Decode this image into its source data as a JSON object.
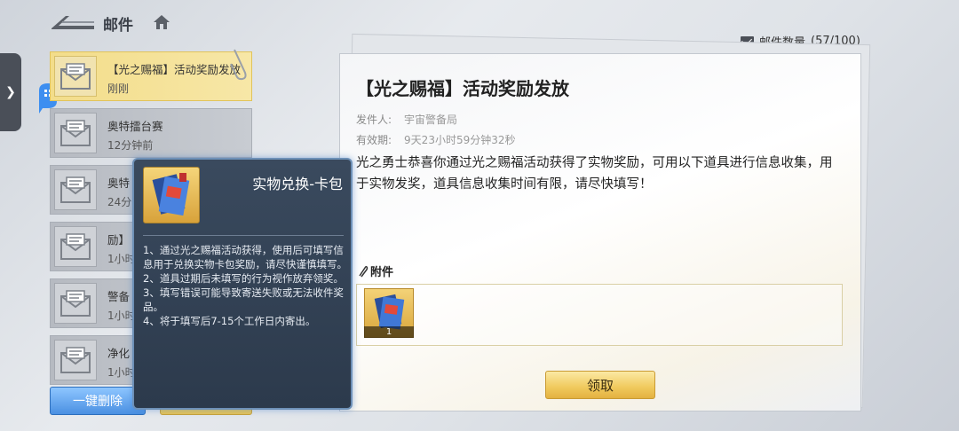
{
  "header": {
    "title": "邮件",
    "mail_count_label": "邮件数量",
    "mail_count_value": "(57/100)"
  },
  "mail_list": [
    {
      "subject": "【光之赐福】活动奖励发放",
      "time": "刚刚",
      "selected": true
    },
    {
      "subject": "奥特擂台赛",
      "time": "12分钟前",
      "selected": false
    },
    {
      "subject": "奥特",
      "time": "24分",
      "selected": false
    },
    {
      "subject": "励】",
      "time": "1小时",
      "selected": false
    },
    {
      "subject": "警备",
      "time": "1小时",
      "selected": false
    },
    {
      "subject": "净化",
      "time": "1小时",
      "selected": false
    }
  ],
  "buttons": {
    "delete_all": "一键删除",
    "claim": "领取"
  },
  "mail_detail": {
    "title": "【光之赐福】活动奖励发放",
    "sender_label": "发件人:",
    "sender": "宇宙警备局",
    "expiry_label": "有效期:",
    "expiry": "9天23小时59分钟32秒",
    "body": "光之勇士恭喜你通过光之赐福活动获得了实物奖励，可用以下道具进行信息收集，用于实物发奖，道具信息收集时间有限，请尽快填写！",
    "attachment_label": "附件",
    "attachment_qty": "1"
  },
  "tooltip": {
    "title": "实物兑换-卡包",
    "lines": [
      "1、通过光之赐福活动获得，使用后可填写信息用于兑换实物卡包奖励，请尽快谨慎填写。",
      "2、道具过期后未填写的行为视作放弃领奖。",
      "3、填写错误可能导致寄送失败或无法收件奖品。",
      "4、将于填写后7-15个工作日内寄出。"
    ]
  },
  "colors": {
    "selected_mail": "#f3dd8a",
    "tooltip_bg": "#2c3a4c",
    "claim_button": "#f0c95c",
    "delete_button": "#4a90e2"
  }
}
